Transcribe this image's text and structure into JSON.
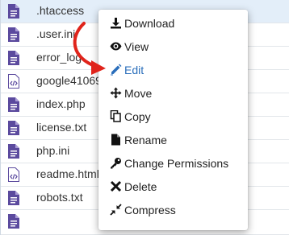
{
  "files": [
    {
      "name": ".htaccess",
      "icon": "file-icon",
      "selected": true
    },
    {
      "name": ".user.ini",
      "icon": "file-icon",
      "selected": false
    },
    {
      "name": "error_log",
      "icon": "file-icon",
      "selected": false
    },
    {
      "name": "google41069",
      "icon": "code-file-icon",
      "selected": false
    },
    {
      "name": "index.php",
      "icon": "file-icon",
      "selected": false
    },
    {
      "name": "license.txt",
      "icon": "file-icon",
      "selected": false
    },
    {
      "name": "php.ini",
      "icon": "file-icon",
      "selected": false
    },
    {
      "name": "readme.html",
      "icon": "code-file-icon",
      "selected": false
    },
    {
      "name": "robots.txt",
      "icon": "file-icon",
      "selected": false
    },
    {
      "name": "",
      "icon": "file-icon",
      "selected": false
    }
  ],
  "context_menu": {
    "items": [
      {
        "label": "Download",
        "icon": "download-icon"
      },
      {
        "label": "View",
        "icon": "eye-icon"
      },
      {
        "label": "Edit",
        "icon": "pencil-icon",
        "highlighted": true
      },
      {
        "label": "Move",
        "icon": "move-icon"
      },
      {
        "label": "Copy",
        "icon": "copy-icon"
      },
      {
        "label": "Rename",
        "icon": "rename-icon"
      },
      {
        "label": "Change Permissions",
        "icon": "key-icon"
      },
      {
        "label": "Delete",
        "icon": "close-icon"
      },
      {
        "label": "Compress",
        "icon": "compress-icon"
      }
    ]
  },
  "colors": {
    "file_icon": "#5b4a9e",
    "selected_row": "#e3eef9",
    "highlight_text": "#2a6ebb",
    "annotation_arrow": "#e0241b"
  }
}
